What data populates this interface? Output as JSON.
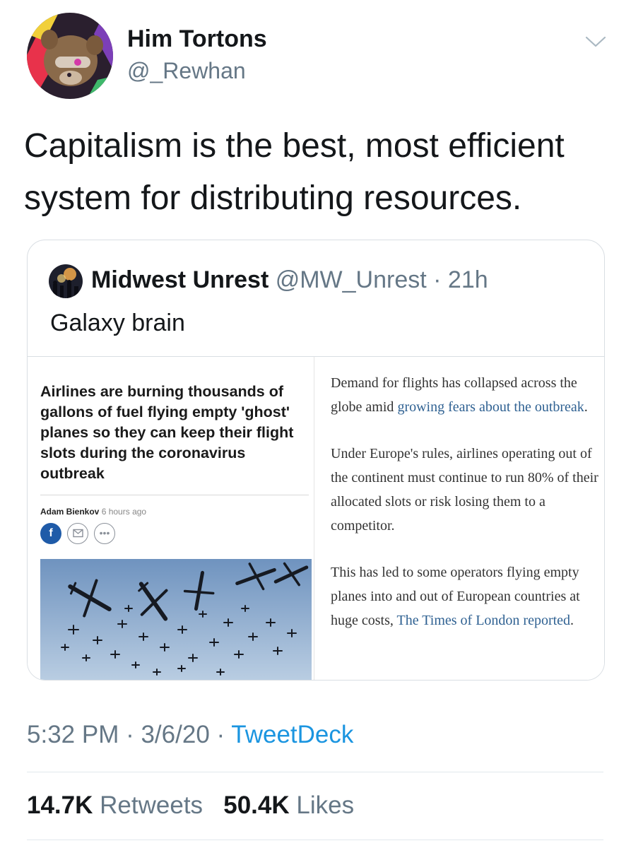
{
  "tweet": {
    "author_name": "Him Tortons",
    "author_handle": "@_Rewhan",
    "text_line1": "Capitalism is the best, most efficient",
    "text_line2": "system for distributing resources.",
    "time": "5:32 PM",
    "date": "3/6/20",
    "separator": " · ",
    "source": "TweetDeck",
    "stats": {
      "retweets_count": "14.7K",
      "retweets_label": "Retweets",
      "likes_count": "50.4K",
      "likes_label": "Likes"
    }
  },
  "quote": {
    "author_name": "Midwest Unrest",
    "author_handle": "@MW_Unrest",
    "age": "21h",
    "text": "Galaxy brain",
    "article": {
      "headline": "Airlines are burning thousands of gallons of fuel flying empty 'ghost' planes so they can keep their flight slots during the coronavirus outbreak",
      "author": "Adam Bienkov",
      "published": "6 hours ago",
      "share_facebook": "f",
      "share_more": "•••",
      "para1_before": "Demand for flights has collapsed across the globe amid ",
      "para1_link": "growing fears about the outbreak",
      "para1_after": ".",
      "para2": "Under Europe's rules, airlines operating out of the continent must continue to run 80% of their allocated slots or risk losing them to a competitor.",
      "para3_before": "This has led to some operators flying empty planes into and out of European countries at huge costs, ",
      "para3_link": "The Times of London reported",
      "para3_after": "."
    }
  },
  "icons": {
    "caret": "chevron-down-icon",
    "mail": "envelope-icon",
    "facebook": "facebook-icon",
    "more": "more-icon"
  },
  "colors": {
    "link_blue": "#1b95e0",
    "secondary_text": "#657786",
    "article_link": "#2f6192",
    "facebook_blue": "#1f5ba8"
  }
}
